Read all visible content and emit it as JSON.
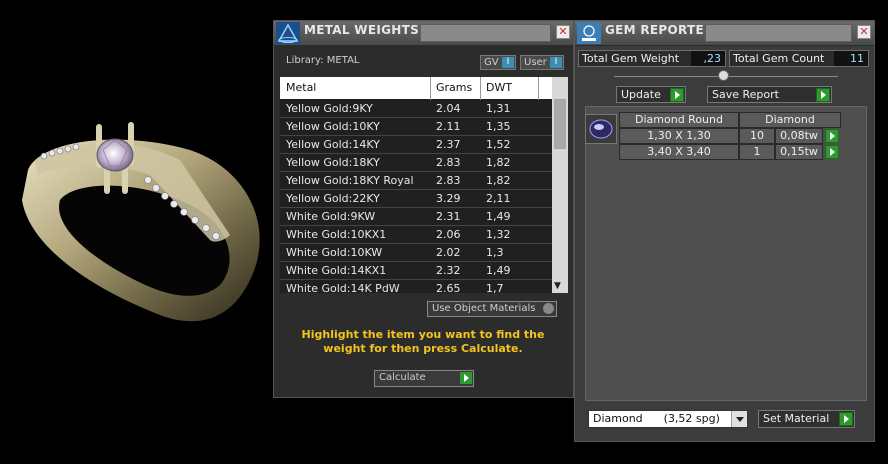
{
  "metal_weights": {
    "title": "METAL WEIGHTS",
    "library_label": "Library: METAL",
    "toggle_gv": "GV",
    "toggle_user": "User",
    "toggle_indicator": "I",
    "columns": [
      "Metal",
      "Grams",
      "DWT"
    ],
    "rows": [
      {
        "metal": "Yellow Gold:9KY",
        "grams": "2.04",
        "dwt": "1,31"
      },
      {
        "metal": "Yellow Gold:10KY",
        "grams": "2.11",
        "dwt": "1,35"
      },
      {
        "metal": "Yellow Gold:14KY",
        "grams": "2.37",
        "dwt": "1,52"
      },
      {
        "metal": "Yellow Gold:18KY",
        "grams": "2.83",
        "dwt": "1,82"
      },
      {
        "metal": "Yellow Gold:18KY Royal",
        "grams": "2.83",
        "dwt": "1,82"
      },
      {
        "metal": "Yellow Gold:22KY",
        "grams": "3.29",
        "dwt": "2,11"
      },
      {
        "metal": "White Gold:9KW",
        "grams": "2.31",
        "dwt": "1,49"
      },
      {
        "metal": "White Gold:10KX1",
        "grams": "2.06",
        "dwt": "1,32"
      },
      {
        "metal": "White Gold:10KW",
        "grams": "2.02",
        "dwt": "1,3"
      },
      {
        "metal": "White Gold:14KX1",
        "grams": "2.32",
        "dwt": "1,49"
      },
      {
        "metal": "White Gold:14K PdW",
        "grams": "2.65",
        "dwt": "1,7"
      }
    ],
    "use_object_materials": "Use Object Materials",
    "hint": "Highlight the item you want to find the weight for then press Calculate.",
    "calculate_label": "Calculate"
  },
  "gem_reporter": {
    "title": "GEM REPORTER",
    "total_weight_label": "Total Gem Weight",
    "total_weight_value": ",23",
    "total_count_label": "Total Gem Count",
    "total_count_value": "11",
    "update_label": "Update",
    "save_report_label": "Save Report",
    "gem_header": {
      "shape": "Diamond Round",
      "material": "Diamond"
    },
    "gems": [
      {
        "size": "1,30 X 1,30",
        "count": "10",
        "weight": "0,08tw"
      },
      {
        "size": "3,40 X 3,40",
        "count": "1",
        "weight": "0,15tw"
      }
    ],
    "material_select": "Diamond      (3,52 spg)",
    "set_material_label": "Set Material"
  },
  "colors": {
    "accent_green": "#2e9a2e",
    "hint_yellow": "#f3c51e",
    "value_cyan": "#9fe0ff"
  }
}
